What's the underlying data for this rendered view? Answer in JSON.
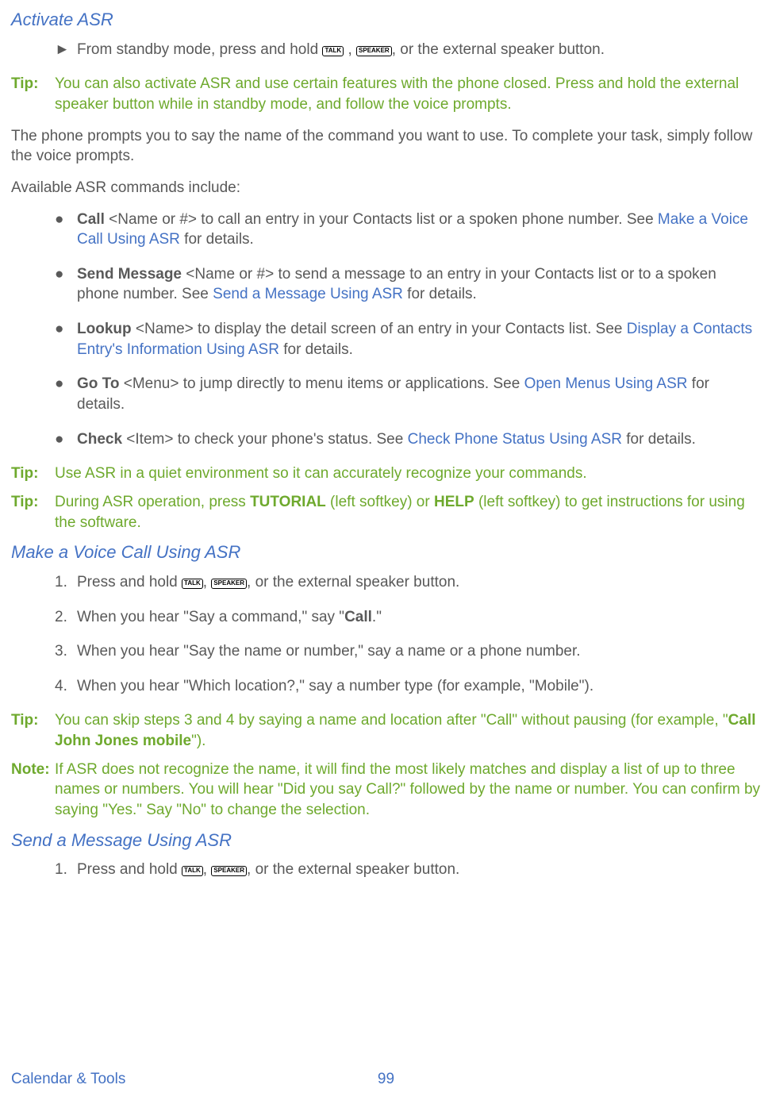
{
  "h1": "Activate ASR",
  "arrow1_a": "From standby mode, press and hold ",
  "arrow1_b": " , ",
  "arrow1_c": ", or the external speaker button.",
  "tip1_label": "Tip:",
  "tip1_body": "You can also activate ASR and use certain features with the phone closed. Press and hold the external speaker button while in standby mode, and follow the voice prompts.",
  "para1": "The phone prompts you to say the name of the command you want to use. To complete your task, simply follow the voice prompts.",
  "para2": "Available ASR commands include:",
  "bul1_bold": "Call",
  "bul1_rest": " <Name or #> to call an entry in your Contacts list or a spoken phone number. See ",
  "bul1_link": "Make a Voice Call Using ASR",
  "bul1_after": " for details.",
  "bul2_bold": "Send Message",
  "bul2_rest": " <Name or #> to send a message to an entry in your Contacts list or to a spoken phone number. See ",
  "bul2_link": "Send a Message Using ASR",
  "bul2_after": " for details.",
  "bul3_bold": "Lookup",
  "bul3_rest": " <Name> to display the detail screen of an entry in your Contacts list. See ",
  "bul3_link": "Display a Contacts Entry's Information Using ASR",
  "bul3_after": " for details.",
  "bul4_bold": "Go To",
  "bul4_rest": " <Menu> to jump directly to menu items or applications. See ",
  "bul4_link": "Open Menus Using ASR",
  "bul4_after": " for details.",
  "bul5_bold": "Check",
  "bul5_rest": " <Item> to check your phone's status. See ",
  "bul5_link": "Check Phone Status Using ASR",
  "bul5_after": " for details.",
  "tip2_label": "Tip:",
  "tip2_body": "Use ASR in a quiet environment so it can accurately recognize your commands.",
  "tip3_label": "Tip:",
  "tip3_a": "During ASR operation, press ",
  "tip3_b": "TUTORIAL",
  "tip3_c": " (left softkey) or ",
  "tip3_d": "HELP",
  "tip3_e": " (left softkey) to get instructions for using the software.",
  "h2": "Make a Voice Call Using ASR",
  "n1_a": "Press and hold ",
  "n1_b": ", ",
  "n1_c": ", or the external speaker button.",
  "n2_a": "When you hear \"Say a command,\" say \"",
  "n2_b": "Call",
  "n2_c": ".\"",
  "n3": "When you hear \"Say the name or number,\" say a name or a phone number.",
  "n4": "When you hear \"Which location?,\" say a number type (for example, \"Mobile\").",
  "tip4_label": "Tip:",
  "tip4_a": "You can skip steps 3 and 4 by saying a name and location after \"Call\" without pausing (for example, \"",
  "tip4_b": "Call John Jones mobile",
  "tip4_c": "\").",
  "note1_label": "Note:",
  "note1_body": "If ASR does not recognize the name, it will find the most likely matches and display a list of up to three names or numbers. You will hear \"Did you say Call?\" followed by the name or number. You can confirm by saying \"Yes.\" Say \"No\" to change the selection.",
  "h3": "Send a Message Using ASR",
  "s1_a": "Press and hold ",
  "s1_b": ", ",
  "s1_c": ", or the external speaker button.",
  "footer_left": "Calendar & Tools",
  "footer_center": "99",
  "key_talk": "TALK",
  "key_speaker": "SPEAKER"
}
